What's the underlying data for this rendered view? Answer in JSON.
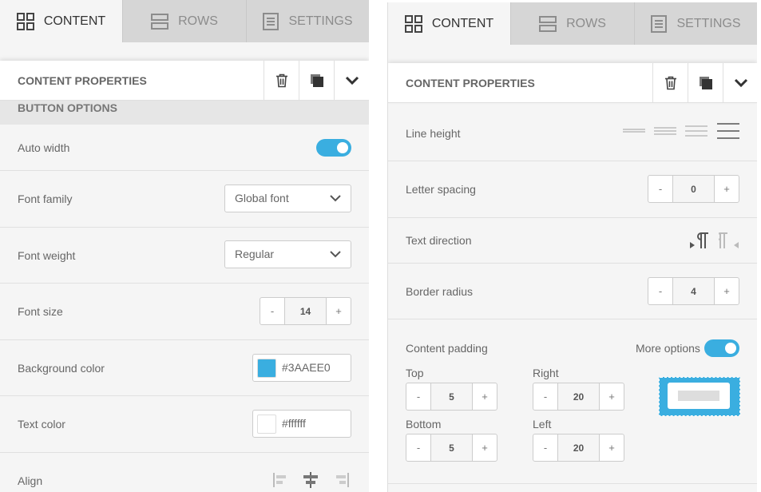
{
  "tabs": {
    "content": "CONTENT",
    "rows": "ROWS",
    "settings": "SETTINGS"
  },
  "header": {
    "title": "CONTENT PROPERTIES"
  },
  "left": {
    "section": "BUTTON OPTIONS",
    "auto_width": {
      "label": "Auto width",
      "enabled": true
    },
    "font_family": {
      "label": "Font family",
      "value": "Global font"
    },
    "font_weight": {
      "label": "Font weight",
      "value": "Regular"
    },
    "font_size": {
      "label": "Font size",
      "value": "14",
      "minus": "-",
      "plus": "+"
    },
    "background_color": {
      "label": "Background color",
      "value": "#3AAEE0",
      "swatch": "#3AAEE0"
    },
    "text_color": {
      "label": "Text color",
      "value": "#ffffff",
      "swatch": "#ffffff"
    },
    "align": {
      "label": "Align"
    }
  },
  "right": {
    "line_height": {
      "label": "Line height"
    },
    "letter_spacing": {
      "label": "Letter spacing",
      "value": "0",
      "minus": "-",
      "plus": "+"
    },
    "text_direction": {
      "label": "Text direction"
    },
    "border_radius": {
      "label": "Border radius",
      "value": "4",
      "minus": "-",
      "plus": "+"
    },
    "content_padding": {
      "label": "Content padding",
      "more_options": "More options",
      "more_options_enabled": true,
      "top": {
        "label": "Top",
        "value": "5"
      },
      "right": {
        "label": "Right",
        "value": "20"
      },
      "bottom": {
        "label": "Bottom",
        "value": "5"
      },
      "left": {
        "label": "Left",
        "value": "20"
      },
      "minus": "-",
      "plus": "+"
    }
  },
  "colors": {
    "accent": "#3aaee0",
    "tab_inactive": "#d6d6d6",
    "panel_bg": "#f5f5f5"
  }
}
